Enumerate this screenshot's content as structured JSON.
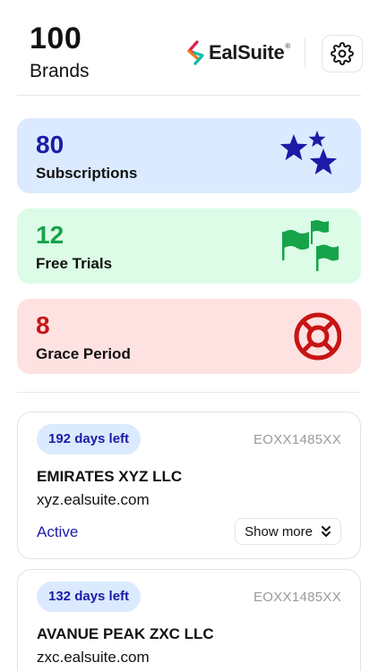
{
  "header": {
    "count": "100",
    "count_label": "Brands",
    "logo_text": "EalSuite",
    "logo_reg": "®",
    "settings_icon": "gear-icon"
  },
  "stats": [
    {
      "value": "80",
      "label": "Subscriptions",
      "icon": "stars-icon",
      "color": "#1e1aa6",
      "bg": "#dbeafe"
    },
    {
      "value": "12",
      "label": "Free Trials",
      "icon": "flags-icon",
      "color": "#16a34a",
      "bg": "#dcfce7"
    },
    {
      "value": "8",
      "label": "Grace Period",
      "icon": "lifebuoy-icon",
      "color": "#c81414",
      "bg": "#fee2e2"
    }
  ],
  "brands": [
    {
      "days_left": "192 days left",
      "code": "EOXX1485XX",
      "name": "EMIRATES XYZ LLC",
      "domain": "xyz.ealsuite.com",
      "status": "Active",
      "show_more": "Show more"
    },
    {
      "days_left": "132 days left",
      "code": "EOXX1485XX",
      "name": "AVANUE PEAK ZXC LLC",
      "domain": "zxc.ealsuite.com"
    }
  ]
}
